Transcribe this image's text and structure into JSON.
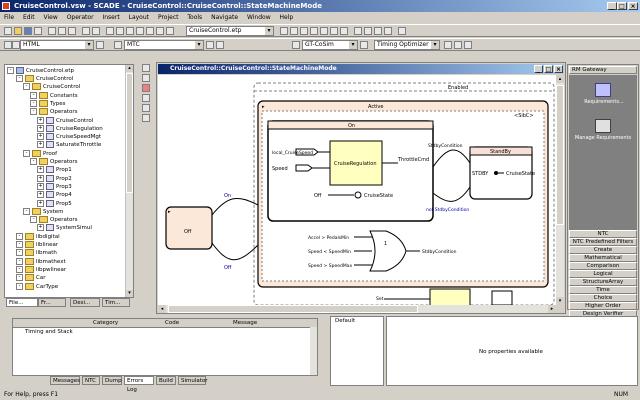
{
  "window": {
    "title": "CruiseControl.vsw - SCADE - CruiseControl::CruiseControl::StateMachineMode"
  },
  "menu": [
    "File",
    "Edit",
    "View",
    "Operator",
    "Insert",
    "Layout",
    "Project",
    "Tools",
    "Navigate",
    "Window",
    "Help"
  ],
  "toolbar1": {
    "combo_project": "CruiseControl.etp"
  },
  "toolbar2": {
    "combo_html": "HTML",
    "combo_mtc": "MTC",
    "combo_codegen": "GT-CoSim",
    "combo_optimizer": "Timing Optimizer"
  },
  "tree": {
    "root": "CruiseControl.etp",
    "items": [
      {
        "label": "CruiseControl",
        "level": 1,
        "type": "folder"
      },
      {
        "label": "CruiseControl",
        "level": 2,
        "type": "folder"
      },
      {
        "label": "Constants",
        "level": 3,
        "type": "folder"
      },
      {
        "label": "Types",
        "level": 3,
        "type": "folder"
      },
      {
        "label": "Operators",
        "level": 3,
        "type": "folder"
      },
      {
        "label": "CruiseControl",
        "level": 4,
        "type": "op"
      },
      {
        "label": "CruiseRegulation",
        "level": 4,
        "type": "op"
      },
      {
        "label": "CruiseSpeedMgt",
        "level": 4,
        "type": "op"
      },
      {
        "label": "SaturateThrottle",
        "level": 4,
        "type": "op"
      },
      {
        "label": "Proof",
        "level": 2,
        "type": "folder"
      },
      {
        "label": "Operators",
        "level": 3,
        "type": "folder"
      },
      {
        "label": "Prop1",
        "level": 4,
        "type": "op"
      },
      {
        "label": "Prop2",
        "level": 4,
        "type": "op"
      },
      {
        "label": "Prop3",
        "level": 4,
        "type": "op"
      },
      {
        "label": "Prop4",
        "level": 4,
        "type": "op"
      },
      {
        "label": "Prop5",
        "level": 4,
        "type": "op"
      },
      {
        "label": "System",
        "level": 2,
        "type": "folder"
      },
      {
        "label": "Operators",
        "level": 3,
        "type": "folder"
      },
      {
        "label": "SystemSimul",
        "level": 4,
        "type": "op"
      },
      {
        "label": "libdigital",
        "level": 1,
        "type": "folder"
      },
      {
        "label": "liblinear",
        "level": 1,
        "type": "folder"
      },
      {
        "label": "libmath",
        "level": 1,
        "type": "folder"
      },
      {
        "label": "libmathext",
        "level": 1,
        "type": "folder"
      },
      {
        "label": "libpwlinear",
        "level": 1,
        "type": "folder"
      },
      {
        "label": "Car",
        "level": 1,
        "type": "folder"
      },
      {
        "label": "CarType",
        "level": 1,
        "type": "folder"
      }
    ]
  },
  "left_tabs": [
    "File...",
    "Fr...",
    "Desi...",
    "Tim..."
  ],
  "diagram": {
    "title": "CruiseControl::CruiseControl::StateMachineMode",
    "enabled_label": "Enabled",
    "active_label": "Active",
    "on_label": "On",
    "off_label": "Off",
    "sibr_label": "<SibC>",
    "standby_label": "StandBy",
    "cruise_reg": "CruiseRegulation",
    "throttle_cmd": "ThrottleCmd",
    "cruise_state": "CruiseState",
    "standby_cond": "StdbyCondition",
    "not_standby": "not StdbyCondition",
    "stdby_label": "STDBY",
    "cruise_state2": "CruiseState",
    "local_speed": "local_CruiseSpeed",
    "speed": "Speed",
    "on_t": "On",
    "off_t": "Off",
    "accel": "Accel > PedalsMin",
    "speed_min": "Speed < SpeedMin",
    "speed_max": "Speed > SpeedMax",
    "or_label": "1",
    "stdby_cond2": "StdbyCondition",
    "set": "Set"
  },
  "right_palette": {
    "header": "RM Gateway",
    "icon1": "Requirements...",
    "icon2": "Manage Requirements",
    "buttons": [
      "NTC",
      "NTC Predefined Filters",
      "Create",
      "Mathematical",
      "Comparison",
      "Logical",
      "StructureArray",
      "Time",
      "Choice",
      "Higher Order",
      "Design Verifier"
    ]
  },
  "output": {
    "columns": [
      "",
      "Category",
      "Code",
      "Message"
    ],
    "row1": "Timing and Stack",
    "tabs": [
      "Messages",
      "NTC",
      "Dump",
      "Errors Log",
      "Build",
      "Simulator"
    ]
  },
  "properties": {
    "left_label": "Default",
    "message": "No properties available"
  },
  "status": {
    "text": "For Help, press F1",
    "num": "NUM"
  },
  "colors": {
    "title_start": "#0a246a",
    "title_end": "#a6caf0",
    "state_fill": "#fce8d8",
    "on_fill": "#ffffc0",
    "standby_fill": "#f8e0d8"
  }
}
